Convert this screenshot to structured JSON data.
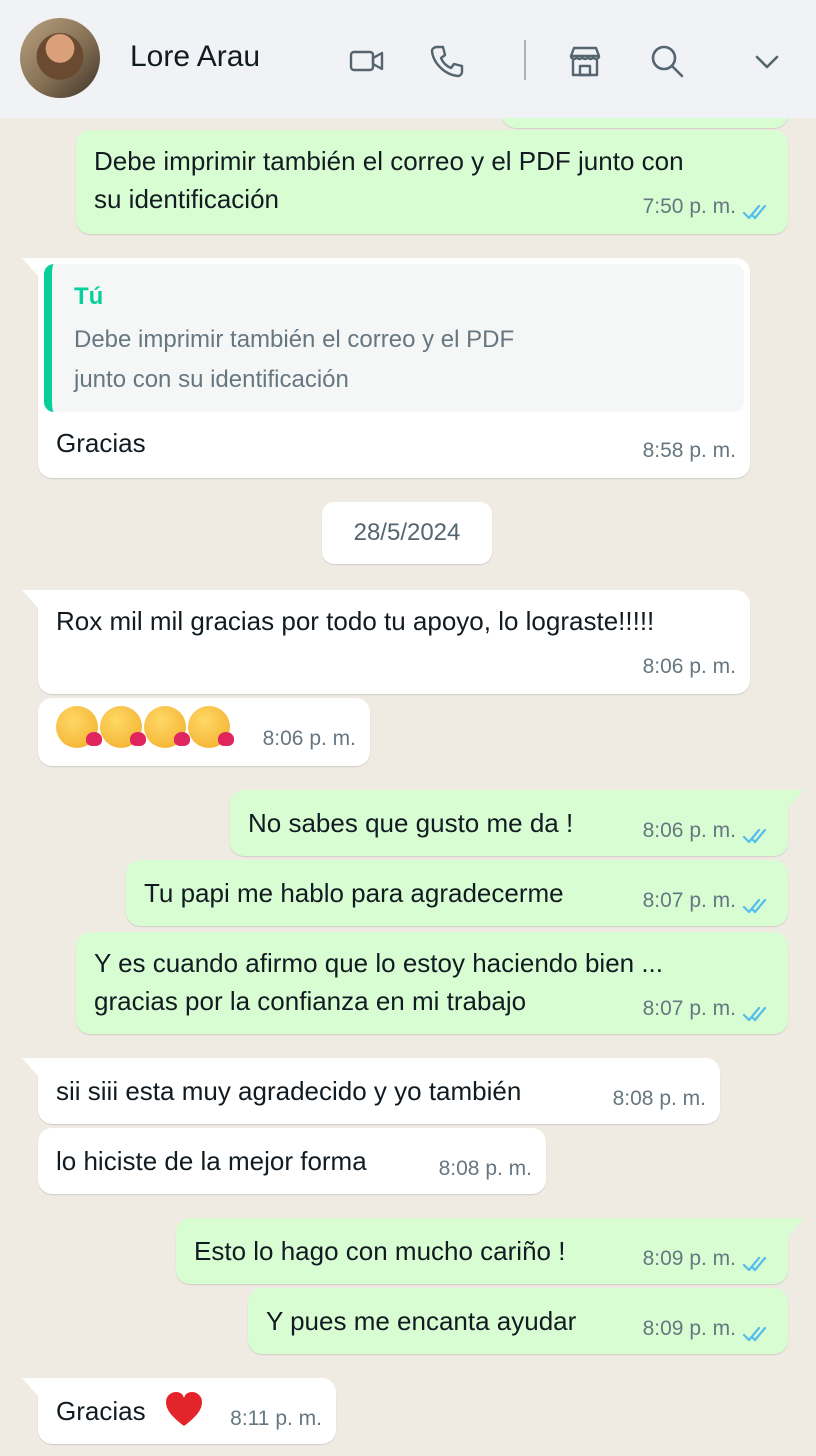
{
  "header": {
    "contact_name": "Lore Arau",
    "icons": [
      "video-call-icon",
      "voice-call-icon",
      "catalog-icon",
      "search-icon",
      "chevron-down-icon"
    ]
  },
  "colors": {
    "outgoing_bubble": "#d9fdd3",
    "incoming_bubble": "#ffffff",
    "read_ticks": "#53bdeb",
    "quote_accent": "#06cf9c",
    "chat_background": "#efeae2"
  },
  "messages": [
    {
      "direction": "out",
      "lines": [
        "Debe imprimir también el correo y el PDF junto con",
        "su identificación"
      ],
      "time": "7:50 p. m.",
      "status": "read"
    },
    {
      "direction": "in",
      "quote_author": "Tú",
      "quote_lines": [
        "Debe imprimir también el correo y el PDF",
        "junto con su identificación"
      ],
      "text": "Gracias",
      "time": "8:58 p. m."
    },
    {
      "direction": "in",
      "text": "Rox mil mil gracias por todo tu apoyo, lo lograste!!!!!",
      "time": "8:06 p. m."
    },
    {
      "direction": "in",
      "emoji": [
        "kissing-face-with-heart-emoji",
        "kissing-face-with-heart-emoji",
        "kissing-face-with-heart-emoji",
        "kissing-face-with-heart-emoji"
      ],
      "time": "8:06 p. m."
    },
    {
      "direction": "out",
      "text": "No sabes que gusto me da !",
      "time": "8:06 p. m.",
      "status": "read"
    },
    {
      "direction": "out",
      "text": "Tu papi me hablo para agradecerme",
      "time": "8:07 p. m.",
      "status": "read"
    },
    {
      "direction": "out",
      "lines": [
        "Y es cuando afirmo que lo estoy haciendo bien ...",
        "gracias por la confianza en mi trabajo"
      ],
      "time": "8:07 p. m.",
      "status": "read"
    },
    {
      "direction": "in",
      "text": "sii siii esta muy agradecido y yo también",
      "time": "8:08 p. m."
    },
    {
      "direction": "in",
      "text": "lo hiciste de la mejor forma",
      "time": "8:08 p. m."
    },
    {
      "direction": "out",
      "text": "Esto lo hago con mucho cariño !",
      "time": "8:09 p. m.",
      "status": "read"
    },
    {
      "direction": "out",
      "text": "Y pues me encanta ayudar",
      "time": "8:09 p. m.",
      "status": "read"
    },
    {
      "direction": "in",
      "text": "Gracias",
      "emoji": [
        "red-heart-emoji"
      ],
      "time": "8:11 p. m."
    }
  ],
  "date_separator": "28/5/2024"
}
